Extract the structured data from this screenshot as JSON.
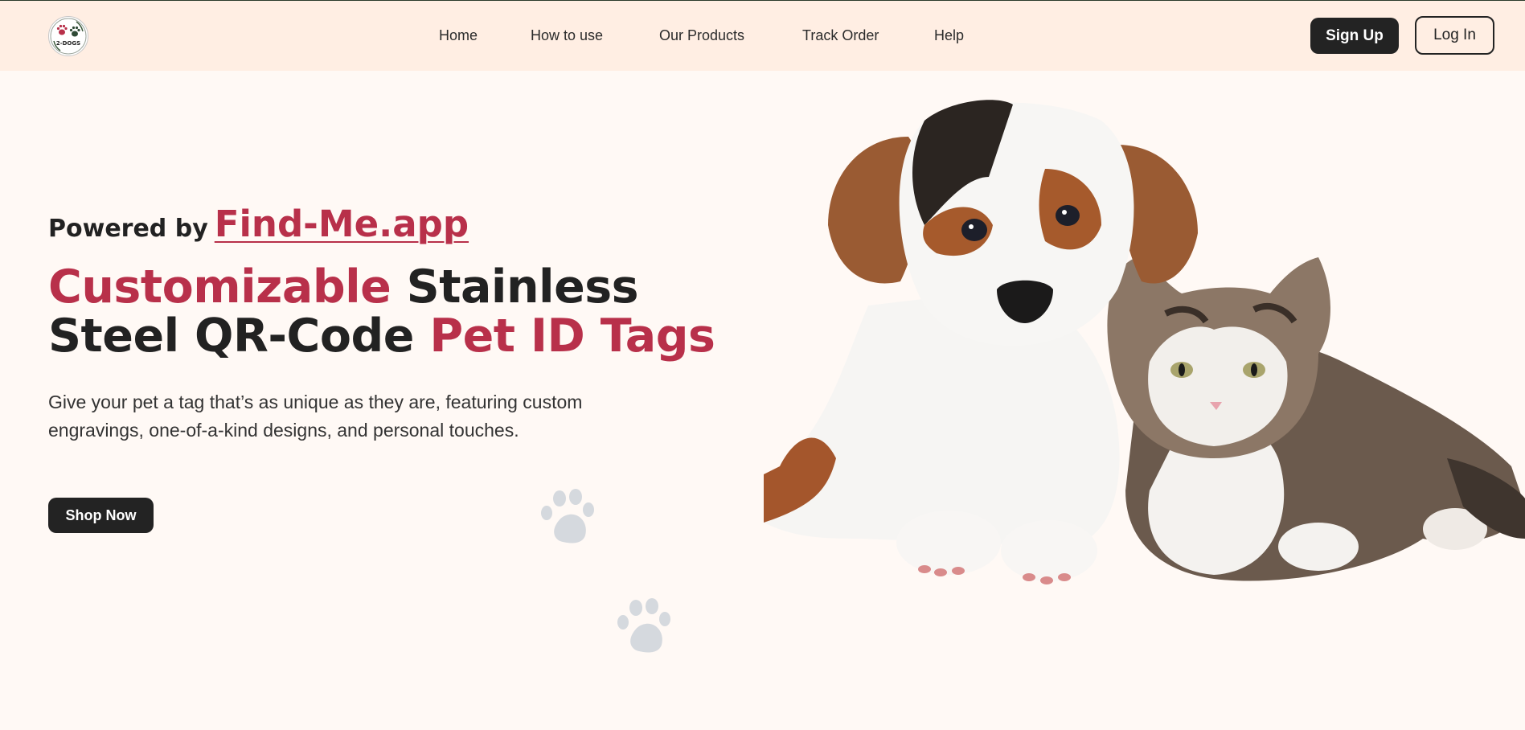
{
  "brand": {
    "logo_text": "2-DOGS"
  },
  "nav": {
    "items": [
      {
        "label": "Home"
      },
      {
        "label": "How to use"
      },
      {
        "label": "Our Products"
      },
      {
        "label": "Track Order"
      },
      {
        "label": "Help"
      }
    ]
  },
  "auth": {
    "signup_label": "Sign Up",
    "login_label": "Log In"
  },
  "hero": {
    "powered_by": "Powered by",
    "powered_link": "Find-Me.app",
    "title_part1": "Customizable",
    "title_part2": " Stainless",
    "title_part3": "Steel QR-Code ",
    "title_part4": "Pet ID Tags",
    "description": "Give your pet a tag that’s as unique as they are, featuring custom engravings, one-of-a-kind designs, and personal touches.",
    "cta_label": "Shop Now"
  },
  "colors": {
    "accent": "#b8304a",
    "dark": "#232323",
    "header_bg": "#ffeee3",
    "page_bg": "#fff9f5"
  },
  "icons": [
    "paw-icon",
    "logo-paw-icon"
  ]
}
